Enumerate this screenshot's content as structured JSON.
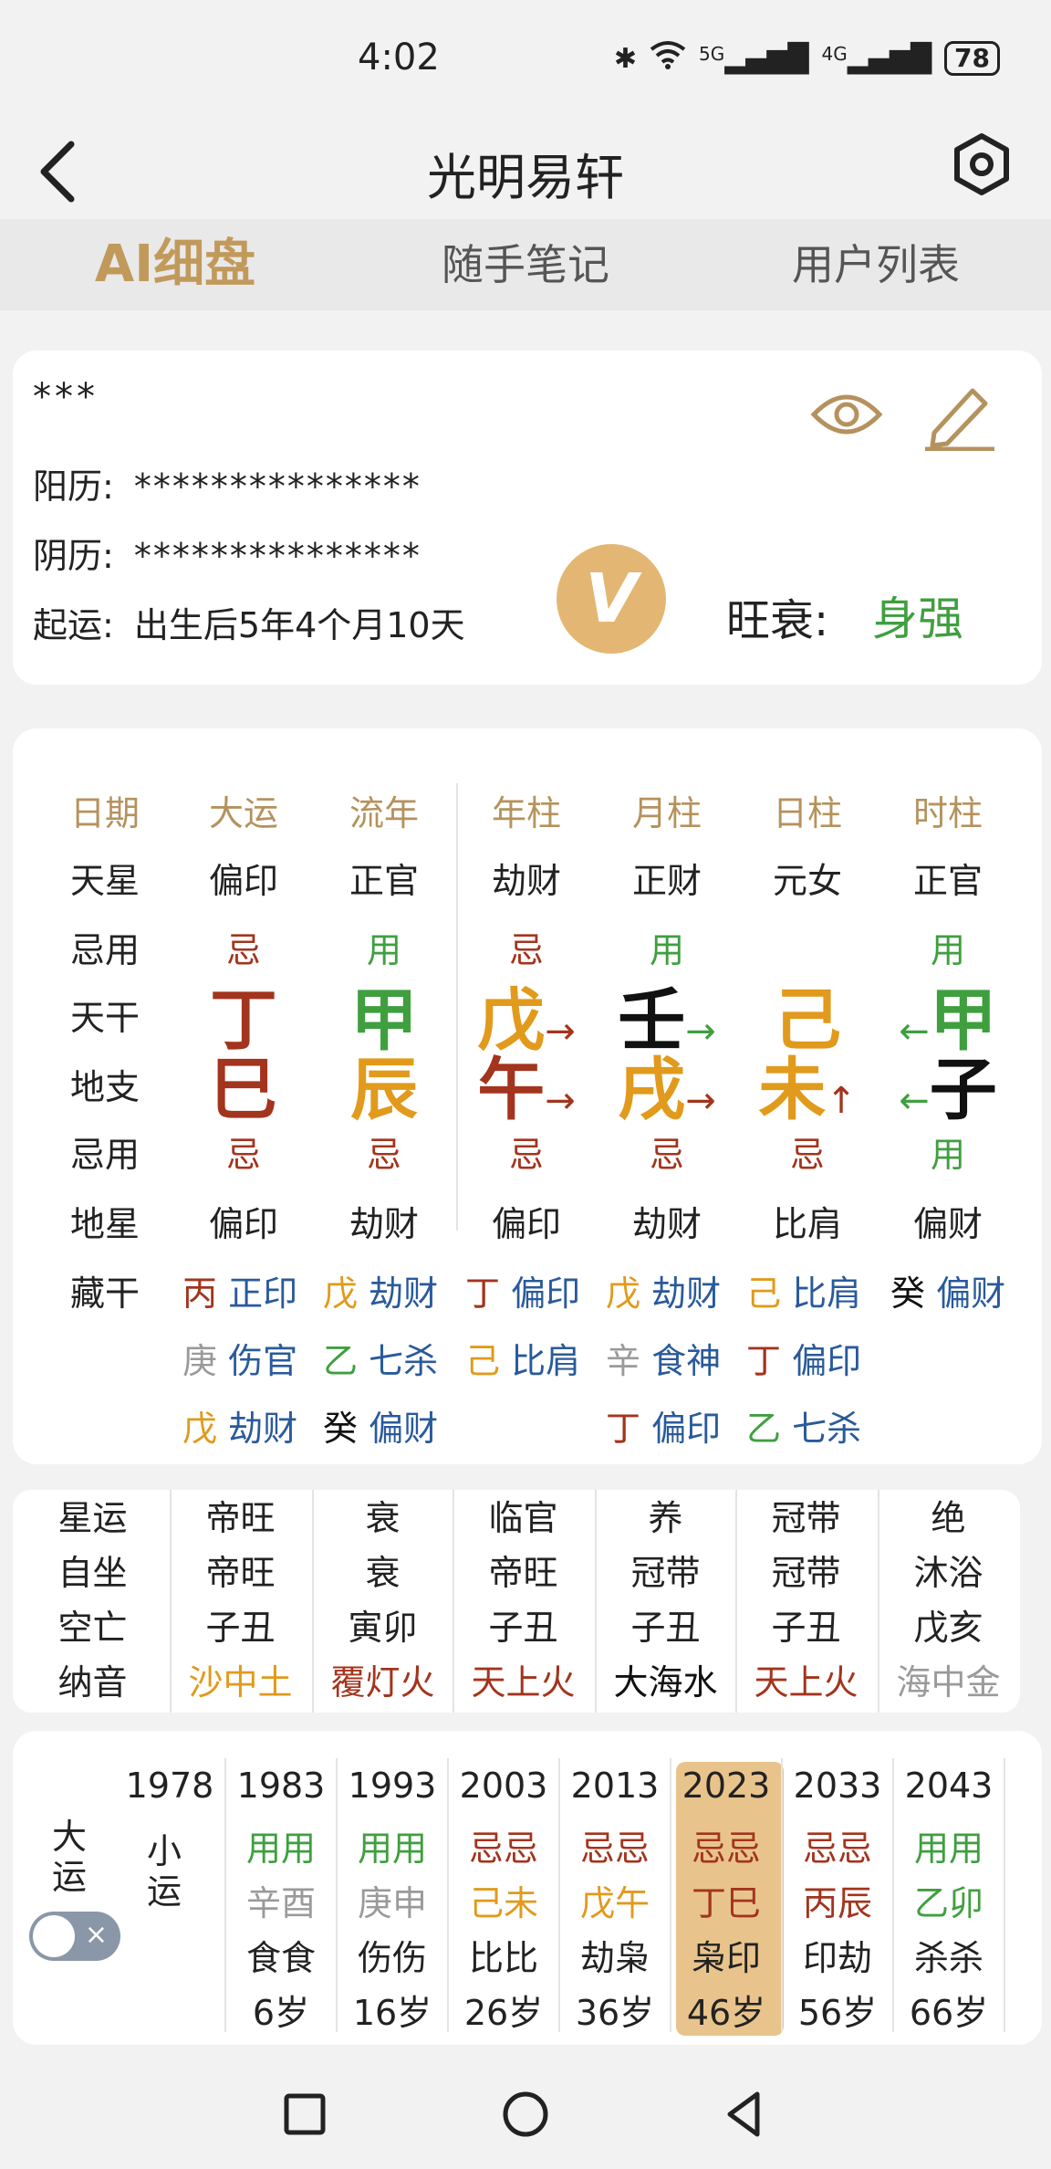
{
  "status": {
    "time": "4:02",
    "battery": "78",
    "net1": "5G",
    "net2": "4G"
  },
  "header": {
    "title": "光明易轩"
  },
  "tabs": [
    {
      "label": "AI细盘",
      "active": true
    },
    {
      "label": "随手笔记",
      "active": false
    },
    {
      "label": "用户列表",
      "active": false
    }
  ],
  "info": {
    "name": "***",
    "solar_label": "阳历:",
    "solar_value": "***************",
    "lunar_label": "阴历:",
    "lunar_value": "***************",
    "luck_label": "起运:",
    "luck_value": "出生后5年4个月10天",
    "vip_text": "V",
    "strength_label": "旺衰:",
    "strength_value": "身强"
  },
  "pillars": {
    "row_labels": [
      "日期",
      "天星",
      "忌用",
      "天干",
      "地支",
      "忌用",
      "地星",
      "藏干"
    ],
    "headers": [
      "大运",
      "流年",
      "年柱",
      "月柱",
      "日柱",
      "时柱"
    ],
    "heaven_star": [
      "偏印",
      "正官",
      "劫财",
      "正财",
      "元女",
      "正官"
    ],
    "use1": [
      "忌",
      "用",
      "忌",
      "用",
      "",
      "用"
    ],
    "stems": [
      "丁",
      "甲",
      "戊",
      "壬",
      "己",
      "甲"
    ],
    "stem_arrows": [
      "",
      "",
      "→",
      "→",
      "",
      "←"
    ],
    "branches": [
      "巳",
      "辰",
      "午",
      "戌",
      "未",
      "子"
    ],
    "branch_arrows": [
      "",
      "",
      "→",
      "→",
      "↑",
      "←"
    ],
    "use2": [
      "忌",
      "忌",
      "忌",
      "忌",
      "忌",
      "用"
    ],
    "earth_star": [
      "偏印",
      "劫财",
      "偏印",
      "劫财",
      "比肩",
      "偏财"
    ],
    "hidden": [
      [
        [
          "丙",
          "正印"
        ],
        [
          "庚",
          "伤官"
        ],
        [
          "戊",
          "劫财"
        ]
      ],
      [
        [
          "戊",
          "劫财"
        ],
        [
          "乙",
          "七杀"
        ],
        [
          "癸",
          "偏财"
        ]
      ],
      [
        [
          "丁",
          "偏印"
        ],
        [
          "己",
          "比肩"
        ]
      ],
      [
        [
          "戊",
          "劫财"
        ],
        [
          "辛",
          "食神"
        ],
        [
          "丁",
          "偏印"
        ]
      ],
      [
        [
          "己",
          "比肩"
        ],
        [
          "丁",
          "偏印"
        ],
        [
          "乙",
          "七杀"
        ]
      ],
      [
        [
          "癸",
          "偏财"
        ]
      ]
    ]
  },
  "stars": {
    "labels": [
      "星运",
      "自坐",
      "空亡",
      "纳音"
    ],
    "cols": [
      [
        "帝旺",
        "帝旺",
        "子丑",
        "沙中土"
      ],
      [
        "衰",
        "衰",
        "寅卯",
        "覆灯火"
      ],
      [
        "临官",
        "帝旺",
        "子丑",
        "天上火"
      ],
      [
        "养",
        "冠带",
        "子丑",
        "大海水"
      ],
      [
        "冠带",
        "冠带",
        "子丑",
        "天上火"
      ],
      [
        "绝",
        "沐浴",
        "戊亥",
        "海中金"
      ]
    ]
  },
  "luck": {
    "side_label_1": "大运",
    "side_label_2": "小运",
    "years": [
      "1978",
      "1983",
      "1993",
      "2003",
      "2013",
      "2023",
      "2033",
      "2043"
    ],
    "use": [
      "用用",
      "用用",
      "忌忌",
      "忌忌",
      "忌忌",
      "忌忌",
      "用用"
    ],
    "pillars": [
      "辛酉",
      "庚申",
      "己未",
      "戊午",
      "丁巳",
      "丙辰",
      "乙卯"
    ],
    "gods": [
      "食食",
      "伤伤",
      "比比",
      "劫枭",
      "枭印",
      "印劫",
      "杀杀"
    ],
    "ages": [
      "6岁",
      "16岁",
      "26岁",
      "36岁",
      "46岁",
      "56岁",
      "66岁"
    ],
    "toggle_symbol": "×"
  }
}
